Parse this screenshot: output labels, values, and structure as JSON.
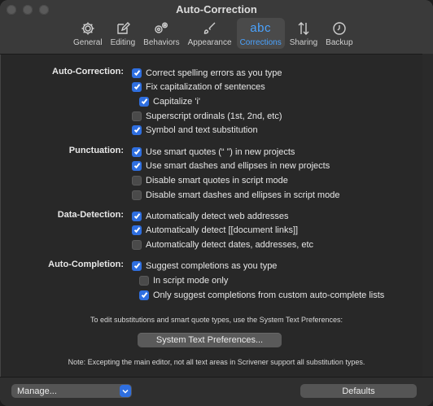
{
  "window": {
    "title": "Auto-Correction"
  },
  "toolbar": {
    "tabs": [
      {
        "label": "General",
        "icon": "gear-icon"
      },
      {
        "label": "Editing",
        "icon": "pencil-square-icon"
      },
      {
        "label": "Behaviors",
        "icon": "gears-icon"
      },
      {
        "label": "Appearance",
        "icon": "paintbrush-icon"
      },
      {
        "label": "Corrections",
        "icon": "abc-icon",
        "icon_text": "abc",
        "selected": true
      },
      {
        "label": "Sharing",
        "icon": "arrows-up-down-icon"
      },
      {
        "label": "Backup",
        "icon": "clock-arrow-icon"
      }
    ]
  },
  "sections": {
    "autocorrection": {
      "label": "Auto-Correction:",
      "items": [
        {
          "label": "Correct spelling errors as you type",
          "checked": true
        },
        {
          "label": "Fix capitalization of sentences",
          "checked": true
        },
        {
          "label": "Capitalize 'i'",
          "checked": true
        },
        {
          "label": "Superscript ordinals (1st, 2nd, etc)",
          "checked": false
        },
        {
          "label": "Symbol and text substitution",
          "checked": true
        }
      ]
    },
    "punctuation": {
      "label": "Punctuation:",
      "items": [
        {
          "label": "Use smart quotes (“ ”) in new projects",
          "checked": true
        },
        {
          "label": "Use smart dashes and ellipses in new projects",
          "checked": true
        },
        {
          "label": "Disable smart quotes in script mode",
          "checked": false
        },
        {
          "label": "Disable smart dashes and ellipses in script mode",
          "checked": false
        }
      ]
    },
    "datadetection": {
      "label": "Data-Detection:",
      "items": [
        {
          "label": "Automatically detect web addresses",
          "checked": true
        },
        {
          "label": "Automatically detect [[document links]]",
          "checked": true
        },
        {
          "label": "Automatically detect dates, addresses, etc",
          "checked": false
        }
      ]
    },
    "autocompletion": {
      "label": "Auto-Completion:",
      "items": [
        {
          "label": "Suggest completions as you type",
          "checked": true
        },
        {
          "label": "In script mode only",
          "checked": false
        },
        {
          "label": "Only suggest completions from custom auto-complete lists",
          "checked": true
        }
      ]
    }
  },
  "info": {
    "edit_text": "To edit substitutions and smart quote types, use the System Text Preferences:",
    "button_label": "System Text Preferences...",
    "note": "Note: Excepting the main editor, not all text areas in Scrivener support all substitution types."
  },
  "footer": {
    "manage_label": "Manage...",
    "defaults_label": "Defaults"
  },
  "colors": {
    "accent": "#2f6fe0",
    "selected_tab": "#4aa3ff"
  }
}
